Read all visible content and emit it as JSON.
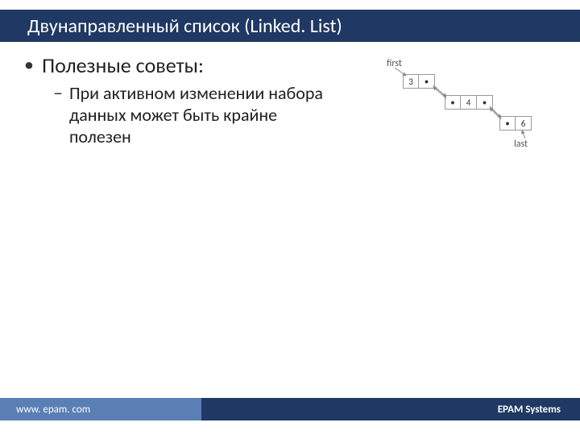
{
  "title": "Двунаправленный список (Linked. List)",
  "bullets": {
    "l1": "Полезные советы:",
    "l2": "При активном изменении набора данных может быть крайне полезен"
  },
  "diagram": {
    "first_label": "first",
    "last_label": "last",
    "nodes": [
      {
        "cells": [
          "3",
          "•"
        ]
      },
      {
        "cells": [
          "•",
          "4",
          "•"
        ]
      },
      {
        "cells": [
          "•",
          "6"
        ]
      }
    ]
  },
  "footer": {
    "url": "www. epam. com",
    "brand": "EPAM Systems"
  }
}
